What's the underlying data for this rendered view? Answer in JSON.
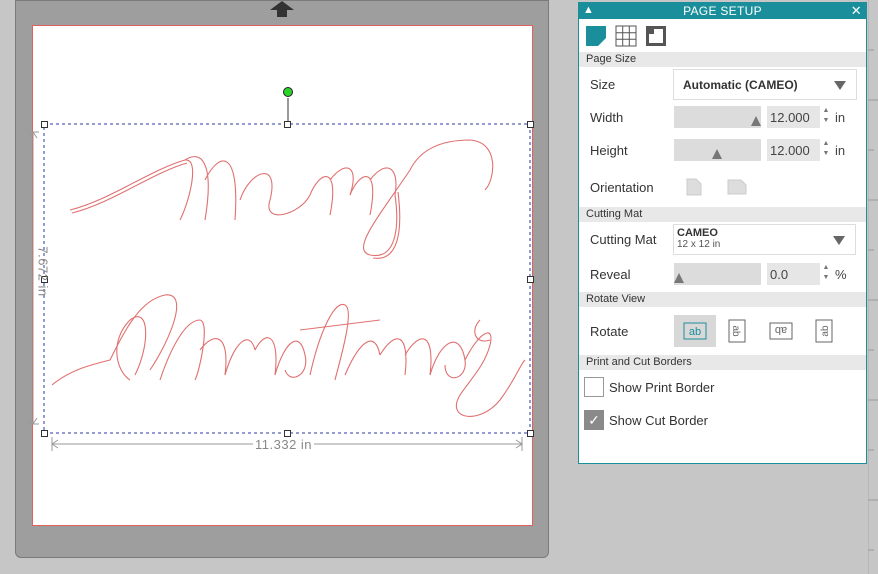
{
  "canvas": {
    "design_text_line1": "merry",
    "design_text_line2": "christmas",
    "width_label": "11.332 in",
    "height_label": "7.672 in"
  },
  "panel": {
    "title": "PAGE SETUP",
    "collapse_icon": "chevron-up-icon",
    "close_icon": "close-icon",
    "tabs": [
      "page-setup-tab-icon",
      "grid-tab-icon",
      "registration-marks-tab-icon"
    ],
    "sections": {
      "page_size": "Page Size",
      "cutting_mat": "Cutting Mat",
      "rotate_view": "Rotate View",
      "borders": "Print and Cut Borders"
    },
    "size": {
      "label": "Size",
      "value": "Automatic (CAMEO)"
    },
    "width": {
      "label": "Width",
      "value": "12.000",
      "unit": "in",
      "slider_fraction": 1.0
    },
    "height": {
      "label": "Height",
      "value": "12.000",
      "unit": "in",
      "slider_fraction": 0.5
    },
    "orientation": {
      "label": "Orientation"
    },
    "cutting_mat": {
      "label": "Cutting Mat",
      "value": "CAMEO",
      "sub": "12 x 12 in"
    },
    "reveal": {
      "label": "Reveal",
      "value": "0.0",
      "unit": "%",
      "slider_fraction": 0.0
    },
    "rotate": {
      "label": "Rotate",
      "options": [
        "ab",
        "ab",
        "ab",
        "ab"
      ],
      "selected": 0
    },
    "show_print_border": {
      "label": "Show Print Border",
      "checked": false
    },
    "show_cut_border": {
      "label": "Show Cut Border",
      "checked": true
    },
    "accent_color": "#1b8e9c"
  }
}
